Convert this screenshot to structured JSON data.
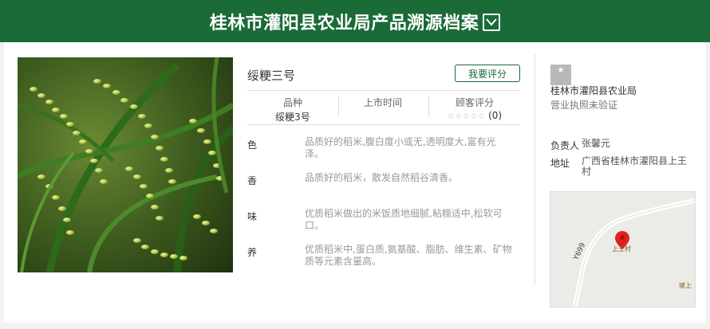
{
  "header": {
    "title": "桂林市灌阳县农业局产品溯源档案"
  },
  "product": {
    "name": "绥粳三号",
    "rate_button": "我要评分",
    "stats": [
      {
        "label": "品种",
        "value": "绥粳3号"
      },
      {
        "label": "上市时间",
        "value": ""
      },
      {
        "label": "顾客评分",
        "stars": "☆☆☆☆☆",
        "count": "(0)"
      }
    ],
    "attributes": [
      {
        "key": "色",
        "value": "品质好的稻米,腹白度小或无,透明度大,富有光泽。"
      },
      {
        "key": "香",
        "value": "品质好的稻米，散发自然稻谷清香。"
      },
      {
        "key": "味",
        "value": "优质稻米做出的米饭质地细腻,粘糯适中,松软可口。"
      },
      {
        "key": "养",
        "value": "优质稻米中,蛋白质,氨基酸、脂肪、维生素、矿物质等元素含量高。"
      }
    ]
  },
  "shop": {
    "name": "桂林市灌阳县农业局",
    "license": "营业执照未验证",
    "owner_label": "负责人",
    "owner": "张馨元",
    "address_label": "地址",
    "address": "广西省桂林市灌阳县上王村"
  },
  "map": {
    "road_label": "Y699",
    "marker_label": "上王村",
    "corner_label": "坡上"
  },
  "colors": {
    "brand_green": "#1a6b38",
    "map_marker": "#e02020"
  },
  "icons": {
    "title_toggle": "chevron-down-icon",
    "shop": "shop-icon",
    "map_marker": "map-pin-icon"
  }
}
